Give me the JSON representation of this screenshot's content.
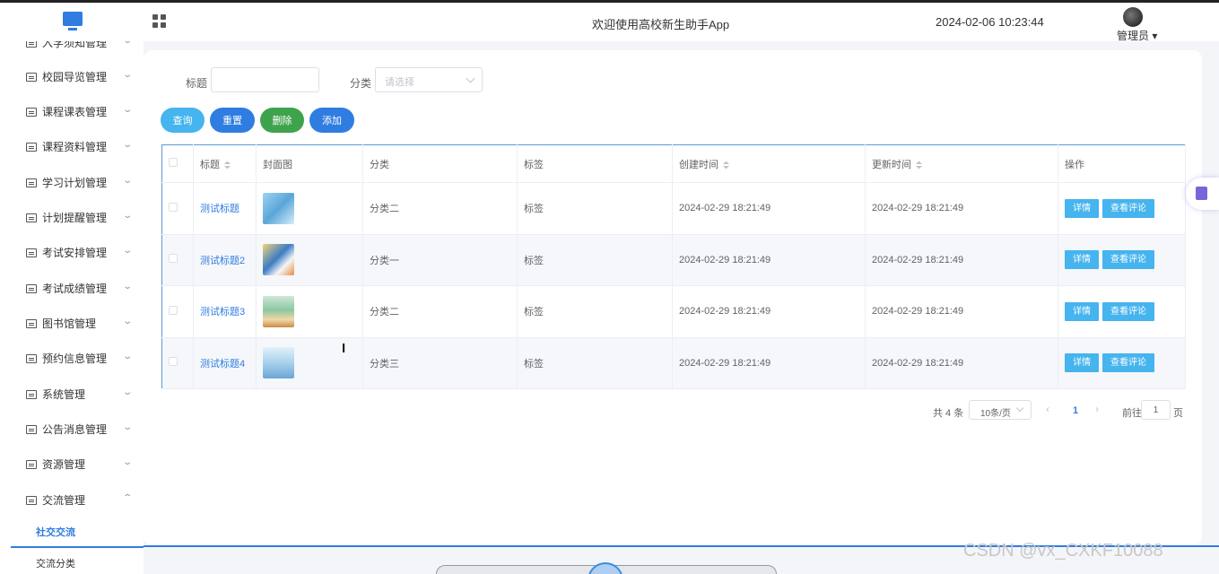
{
  "header": {
    "app_title": "欢迎使用高校新生助手App",
    "datetime": "2024-02-06 10:23:44",
    "user": "管理员 ▾"
  },
  "sidebar": {
    "items": [
      {
        "label": "入学须知管理",
        "expanded": false
      },
      {
        "label": "校园导览管理",
        "expanded": false
      },
      {
        "label": "课程课表管理",
        "expanded": false
      },
      {
        "label": "课程资料管理",
        "expanded": false
      },
      {
        "label": "学习计划管理",
        "expanded": false
      },
      {
        "label": "计划提醒管理",
        "expanded": false
      },
      {
        "label": "考试安排管理",
        "expanded": false
      },
      {
        "label": "考试成绩管理",
        "expanded": false
      },
      {
        "label": "图书馆管理",
        "expanded": false
      },
      {
        "label": "预约信息管理",
        "expanded": false
      },
      {
        "label": "系统管理",
        "expanded": false
      },
      {
        "label": "公告消息管理",
        "expanded": false
      },
      {
        "label": "资源管理",
        "expanded": false
      },
      {
        "label": "交流管理",
        "expanded": true
      }
    ],
    "submenu_active": "社交交流",
    "submenu_next": "交流分类"
  },
  "filters": {
    "title_label": "标题",
    "title_value": "",
    "category_label": "分类",
    "category_placeholder": "请选择"
  },
  "buttons": {
    "query": "查询",
    "reset": "重置",
    "delete": "删除",
    "add": "添加"
  },
  "colors": {
    "query": "#46b4ee",
    "reset": "#2f7de1",
    "delete": "#3fa34d",
    "add": "#2f7de1",
    "accent": "#2f7de1"
  },
  "table": {
    "headers": {
      "title": "标题",
      "cover": "封面图",
      "category": "分类",
      "tag": "标签",
      "created": "创建时间",
      "updated": "更新时间",
      "actions": "操作"
    },
    "rows": [
      {
        "title": "测试标题",
        "category": "分类二",
        "tag": "标签",
        "created": "2024-02-29 18:21:49",
        "updated": "2024-02-29 18:21:49"
      },
      {
        "title": "测试标题2",
        "category": "分类一",
        "tag": "标签",
        "created": "2024-02-29 18:21:49",
        "updated": "2024-02-29 18:21:49"
      },
      {
        "title": "测试标题3",
        "category": "分类二",
        "tag": "标签",
        "created": "2024-02-29 18:21:49",
        "updated": "2024-02-29 18:21:49"
      },
      {
        "title": "测试标题4",
        "category": "分类三",
        "tag": "标签",
        "created": "2024-02-29 18:21:49",
        "updated": "2024-02-29 18:21:49"
      }
    ],
    "action_detail": "详情",
    "action_comments": "查看评论"
  },
  "pagination": {
    "total": "共 4 条",
    "page_size": "10条/页",
    "current": "1",
    "goto_label": "前往",
    "goto_value": "1",
    "page_suffix": "页"
  },
  "watermark": "CSDN @vx_CXKF10088"
}
